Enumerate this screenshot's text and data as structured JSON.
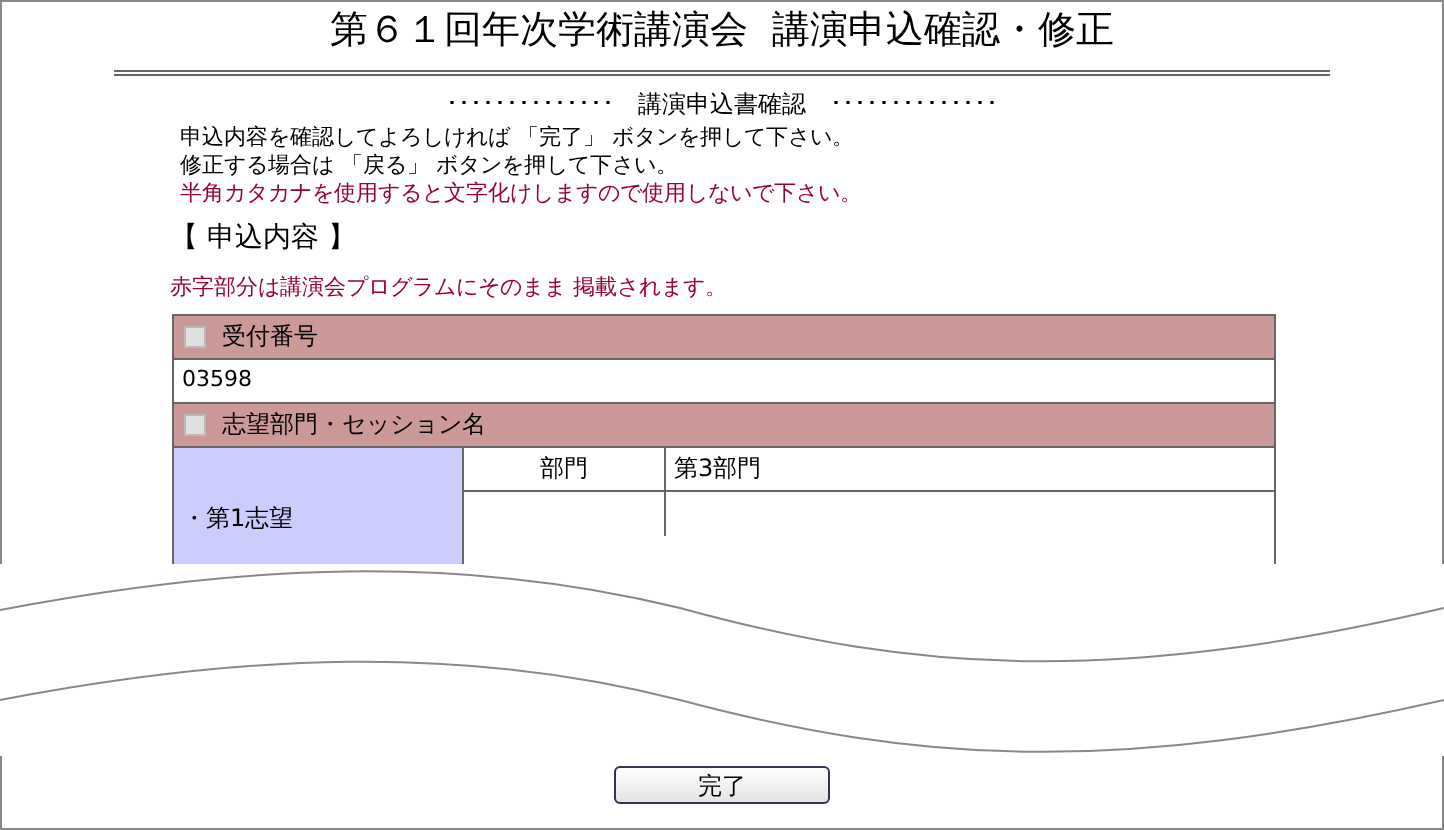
{
  "title": "第６１回年次学術講演会  講演申込確認・修正",
  "subtitle": {
    "decor": "･･････････････",
    "text": "講演申込書確認"
  },
  "instructions": [
    {
      "text": "申込内容を確認してよろしければ 「完了」 ボタンを押して下さい。",
      "kind": "normal"
    },
    {
      "text": "修正する場合は 「戻る」 ボタンを押して下さい。",
      "kind": "normal"
    },
    {
      "text": "半角カタカナを使用すると文字化けしますので使用しないで下さい。",
      "kind": "warning"
    }
  ],
  "section_heading": "【 申込内容 】",
  "note": "赤字部分は講演会プログラムにそのまま 掲載されます。",
  "table": [
    {
      "kind": "header",
      "label": "受付番号",
      "checked": false
    },
    {
      "kind": "value",
      "text": "03598"
    },
    {
      "kind": "header",
      "label": "志望部門・セッション名",
      "checked": false
    },
    {
      "kind": "choice",
      "label": "・第1志望",
      "rows": [
        {
          "field": "部門",
          "value": "第3部門"
        }
      ]
    }
  ],
  "button": "完了"
}
